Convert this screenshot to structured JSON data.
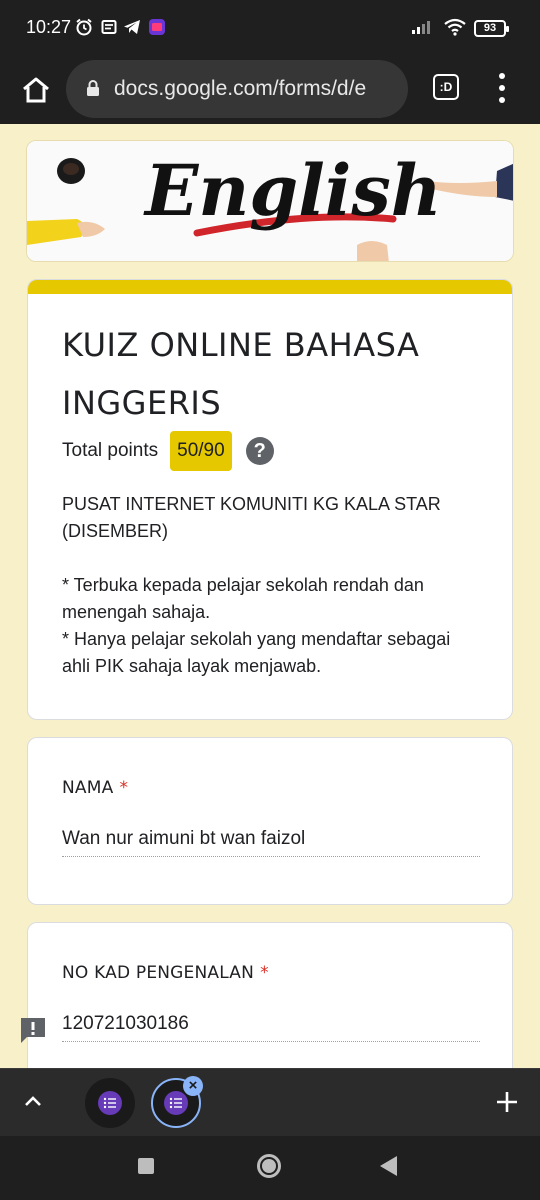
{
  "status_bar": {
    "time": "10:27",
    "battery": "93",
    "icons": [
      "alarm-icon",
      "notes-icon",
      "telegram-icon",
      "app-icon",
      "signal-icon",
      "wifi-icon",
      "battery-icon"
    ]
  },
  "browser": {
    "url": "docs.google.com/forms/d/e",
    "tab_switcher_label": ":D",
    "icons": [
      "home-icon",
      "lock-icon",
      "more-vert-icon"
    ]
  },
  "banner": {
    "text": "English"
  },
  "form": {
    "title": "KUIZ ONLINE BAHASA INGGERIS",
    "points_label": "Total points",
    "points_value": "50/90",
    "help_glyph": "?",
    "description": {
      "line1": "PUSAT INTERNET KOMUNITI KG KALA STAR (DISEMBER)",
      "line2": "* Terbuka kepada pelajar sekolah rendah dan menengah sahaja.",
      "line3": "* Hanya pelajar sekolah yang mendaftar sebagai ahli PIK sahaja layak menjawab."
    },
    "accent_color": "#e5c800",
    "questions": [
      {
        "label": "NAMA",
        "required_mark": "*",
        "answer": "Wan nur aimuni bt wan faizol"
      },
      {
        "label": "NO KAD PENGENALAN",
        "required_mark": "*",
        "answer": "120721030186"
      }
    ]
  },
  "tab_strip": {
    "close_glyph": "×",
    "icons": [
      "chevron-up-icon",
      "forms-icon",
      "plus-icon"
    ]
  }
}
